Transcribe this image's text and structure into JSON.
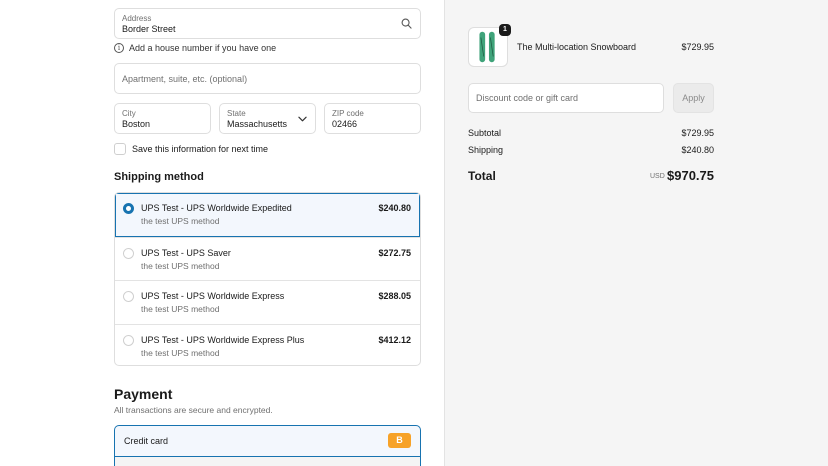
{
  "address": {
    "label": "Address",
    "value": "Border Street",
    "hint": "Add a house number if you have one",
    "apartment_placeholder": "Apartment, suite, etc. (optional)"
  },
  "city": {
    "label": "City",
    "value": "Boston"
  },
  "state": {
    "label": "State",
    "value": "Massachusetts"
  },
  "zip": {
    "label": "ZIP code",
    "value": "02466"
  },
  "save_info_label": "Save this information for next time",
  "shipping": {
    "title": "Shipping method",
    "options": [
      {
        "name": "UPS Test - UPS Worldwide Expedited",
        "desc": "the test UPS method",
        "price": "$240.80",
        "selected": true
      },
      {
        "name": "UPS Test - UPS Saver",
        "desc": "the test UPS method",
        "price": "$272.75",
        "selected": false
      },
      {
        "name": "UPS Test - UPS Worldwide Express",
        "desc": "the test UPS method",
        "price": "$288.05",
        "selected": false
      },
      {
        "name": "UPS Test - UPS Worldwide Express Plus",
        "desc": "the test UPS method",
        "price": "$412.12",
        "selected": false
      }
    ]
  },
  "payment": {
    "title": "Payment",
    "subtitle": "All transactions are secure and encrypted.",
    "method_label": "Credit card",
    "badge": "B"
  },
  "cart": {
    "quantity": "1",
    "product_name": "The Multi-location Snowboard",
    "product_price": "$729.95",
    "discount_placeholder": "Discount code or gift card",
    "apply_label": "Apply",
    "subtotal_label": "Subtotal",
    "subtotal_value": "$729.95",
    "shipping_label": "Shipping",
    "shipping_value": "$240.80",
    "total_label": "Total",
    "currency": "USD",
    "total_value": "$970.75"
  },
  "colors": {
    "accent": "#1773b0",
    "bitcoin": "#f7a228",
    "snowboard": "#3fa37a"
  }
}
